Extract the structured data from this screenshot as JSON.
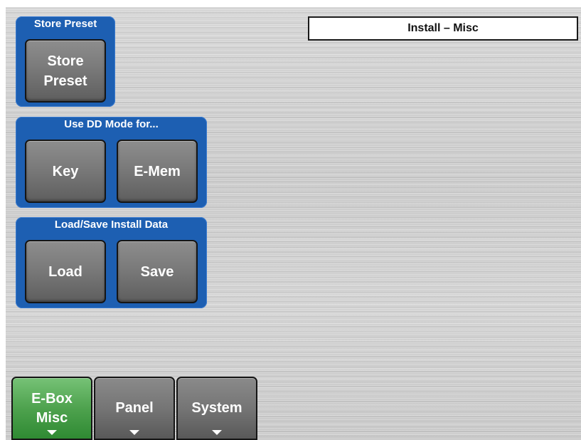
{
  "header": {
    "title": "Install – Misc"
  },
  "store_preset": {
    "title": "Store Preset",
    "button_line1": "Store",
    "button_line2": "Preset"
  },
  "dd_mode": {
    "title": "Use DD Mode for...",
    "key_label": "Key",
    "emem_label": "E-Mem"
  },
  "install_data": {
    "title": "Load/Save Install Data",
    "load_label": "Load",
    "save_label": "Save"
  },
  "tabs": [
    {
      "line1": "E-Box",
      "line2": "Misc",
      "active": true
    },
    {
      "line1": "Panel",
      "line2": "",
      "active": false
    },
    {
      "line1": "System",
      "line2": "",
      "active": false
    }
  ],
  "colors": {
    "group_blue": "#1d5fb2",
    "active_tab_green": "#4ea24e",
    "button_gray": "#7a7a7a"
  }
}
